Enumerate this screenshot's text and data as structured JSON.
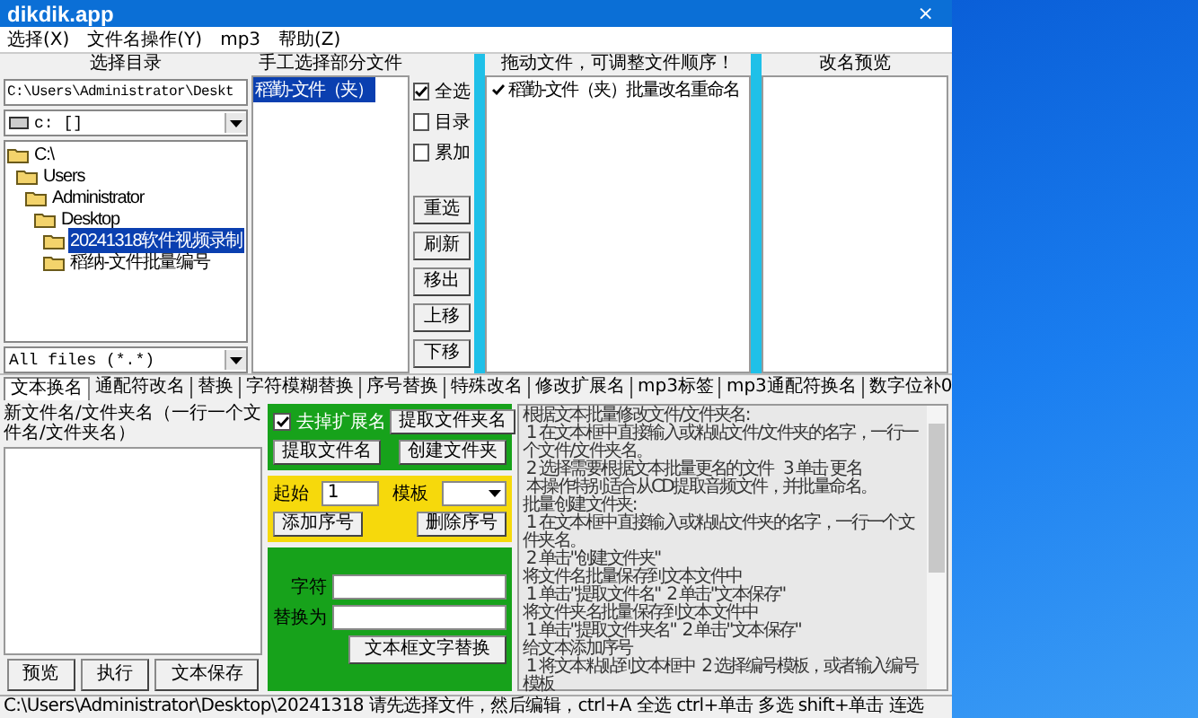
{
  "window": {
    "title": "dikdik.app",
    "close": "×"
  },
  "menu": [
    "选择(X)",
    "文件名操作(Y)",
    "mp3",
    "帮助(Z)"
  ],
  "directory": {
    "heading": "选择目录",
    "path": "C:\\Users\\Administrator\\Deskt",
    "drive": "c: []",
    "filter": "All files (*.*)",
    "tree": [
      {
        "label": "C:\\",
        "selected": false,
        "children": [
          {
            "label": "Users",
            "selected": false,
            "children": [
              {
                "label": "Administrator",
                "selected": false,
                "children": [
                  {
                    "label": "Desktop",
                    "selected": false,
                    "children": [
                      {
                        "label": "20241318软件视频录制",
                        "selected": true
                      },
                      {
                        "label": "稻纳-文件批量编号",
                        "selected": false
                      }
                    ]
                  }
                ]
              }
            ]
          }
        ]
      }
    ]
  },
  "manual": {
    "heading": "手工选择部分文件",
    "files": [
      {
        "label": "稻勤-文件（夹）",
        "selected": true
      }
    ]
  },
  "options": [
    {
      "label": "全选",
      "checked": true
    },
    {
      "label": "目录",
      "checked": false
    },
    {
      "label": "累加",
      "checked": false
    }
  ],
  "actions": [
    "重选",
    "刷新",
    "移出",
    "上移",
    "下移"
  ],
  "order": {
    "heading": "拖动文件，可调整文件顺序！",
    "files": [
      {
        "label": "稻勤-文件（夹）批量改名重命名",
        "checked": true
      }
    ]
  },
  "preview": {
    "heading": "改名预览"
  },
  "tabs": [
    {
      "label": "文本换名",
      "selected": true
    },
    {
      "label": "通配符改名",
      "selected": false
    },
    {
      "label": "替换",
      "selected": false
    },
    {
      "label": "字符模糊替换",
      "selected": false
    },
    {
      "label": "序号替换",
      "selected": false
    },
    {
      "label": "特殊改名",
      "selected": false
    },
    {
      "label": "修改扩展名",
      "selected": false
    },
    {
      "label": "mp3标签",
      "selected": false
    },
    {
      "label": "mp3通配符换名",
      "selected": false
    },
    {
      "label": "数字位补0",
      "selected": false
    }
  ],
  "text_rename": {
    "label": "新文件名/文件夹名（一行一个文件名/文件夹名）",
    "buttons": [
      "预览",
      "执行",
      "文本保存"
    ]
  },
  "extract_panel": {
    "strip_extension": {
      "label": "去掉扩展名",
      "checked": true
    },
    "buttons": [
      "提取文件夹名",
      "提取文件名",
      "创建文件夹"
    ]
  },
  "number_panel": {
    "start_label": "起始",
    "start_value": "1",
    "template_label": "模板",
    "buttons": [
      "添加序号",
      "删除序号"
    ]
  },
  "replace_panel": {
    "find_label": "字符",
    "replace_label": "替换为",
    "button": "文本框文字替换"
  },
  "help_text": [
    "根据文本批量修改文件/文件夹名:",
    " 1 在文本框中直接输入或粘贴文件/文件夹的名字，一行一个文件/文件夹名。",
    " 2 选择需要根据文本批量更名的文件   3 单击 更名",
    " 本操作特别适合从CD提取音频文件，并批量命名。",
    "批量创建文件夹:",
    " 1 在文本框中直接输入或粘贴文件夹的名字，一行一个文件夹名。",
    " 2 单击\"创建文件夹\"",
    "将文件名批量保存到文本文件中",
    " 1 单击\"提取文件名\"  2 单击\"文本保存\"",
    "将文件夹名批量保存到文本文件中",
    " 1 单击\"提取文件夹名\"  2 单击\"文本保存\"",
    "给文本添加序号",
    " 1 将文本粘贴到文本框中  2 选择编号模板，或者输入编号模板"
  ],
  "status_bar": "C:\\Users\\Administrator\\Desktop\\20241318 请先选择文件，然后编辑，ctrl+A 全选 ctrl+单击 多选 shift+单击 连选"
}
